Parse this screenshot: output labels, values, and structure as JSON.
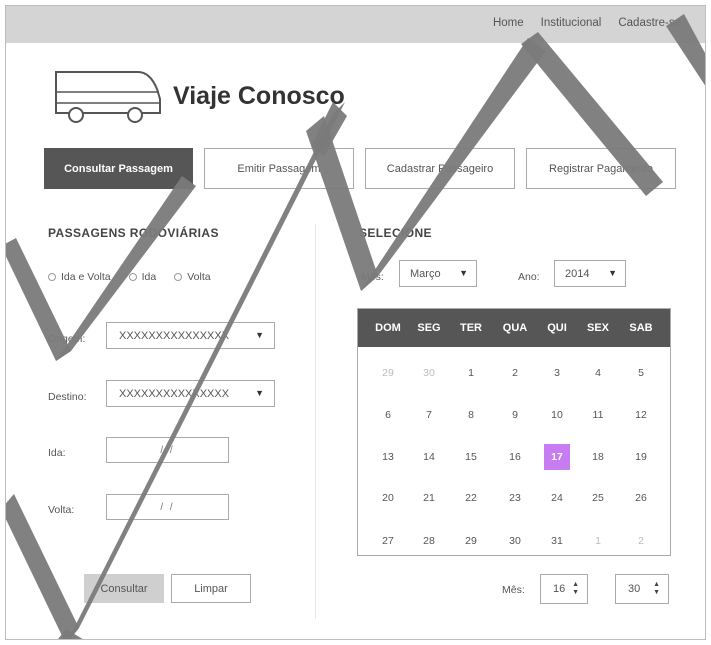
{
  "topnav": {
    "items": [
      "Home",
      "Institucional",
      "Cadastre-se"
    ]
  },
  "brand": {
    "title": "Viaje Conosco"
  },
  "tabs": {
    "consultar": "Consultar Passagem",
    "emitir": "Emitir Passagem",
    "cadastrar": "Cadastrar Passageiro",
    "registrar": "Registrar Pagamento"
  },
  "left": {
    "title": "PASSAGENS RODOVIÁRIAS",
    "radios": [
      "Ida e Volta",
      "Ida",
      "Volta"
    ],
    "origem_label": "Origem:",
    "origem_value": "XXXXXXXXXXXXXXX",
    "destino_label": "Destino:",
    "destino_value": "XXXXXXXXXXXXXXX",
    "ida_label": "Ida:",
    "ida_value": "/ /",
    "volta_label": "Volta:",
    "volta_value": "/ /",
    "consultar_btn": "Consultar",
    "limpar_btn": "Limpar"
  },
  "right": {
    "title": "SELECIONE",
    "mes_label": "Mês:",
    "mes_value": "Março",
    "ano_label": "Ano:",
    "ano_value": "2014",
    "spin_label": "Mês:",
    "spin1": "16",
    "spin2": "30"
  },
  "calendar": {
    "weekdays": [
      "DOM",
      "SEG",
      "TER",
      "QUA",
      "QUI",
      "SEX",
      "SAB"
    ],
    "weeks": [
      [
        "29",
        "30",
        "1",
        "2",
        "3",
        "4",
        "5"
      ],
      [
        "6",
        "7",
        "8",
        "9",
        "10",
        "11",
        "12"
      ],
      [
        "13",
        "14",
        "15",
        "16",
        "17",
        "18",
        "19"
      ],
      [
        "20",
        "21",
        "22",
        "23",
        "24",
        "25",
        "26"
      ],
      [
        "27",
        "28",
        "29",
        "30",
        "31",
        "1",
        "2"
      ]
    ],
    "muted": [
      [
        0,
        0
      ],
      [
        0,
        1
      ],
      [
        4,
        5
      ],
      [
        4,
        6
      ]
    ],
    "selected": [
      2,
      4
    ],
    "selected_color": "#c77cf2",
    "header_color": "#565656"
  }
}
